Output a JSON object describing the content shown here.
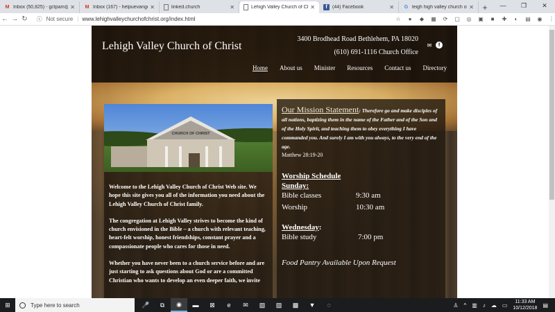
{
  "browser": {
    "tabs": [
      {
        "label": "Inbox (50,825) - gctpam@g...",
        "icon": "gmail-icon"
      },
      {
        "label": "Inbox (167) - helpuevangel...",
        "icon": "gmail-icon"
      },
      {
        "label": "linked.church",
        "icon": "document-icon"
      },
      {
        "label": "Lehigh Valley Church of Chr...",
        "icon": "document-icon",
        "active": true
      },
      {
        "label": "(44) Facebook",
        "icon": "facebook-icon"
      },
      {
        "label": "leigh high valley church of C...",
        "icon": "google-icon"
      }
    ],
    "security_label": "Not secure",
    "url": "www.lehighvalleychurchofchrist.org/index.html"
  },
  "site": {
    "title": "Lehigh Valley Church of Christ",
    "address": "3400 Brodhead Road  Bethlehem, PA 18020",
    "phone": "(610) 691-1116 Church Office",
    "nav": [
      "Home",
      "About us",
      "Minister",
      "Resources",
      "Contact us",
      "Directory"
    ],
    "photo_sign": "CHURCH OF CHRIST",
    "welcome": [
      "Welcome to the Lehigh Valley Church of Christ Web site. We hope this site gives you all of the information you need about the Lehigh Valley Church of Christ family.",
      "The congregation at Lehigh Valley strives to become the kind of church envisioned in the Bible – a church with relevant teaching, heart-felt worship, honest friendships, constant prayer and a compassionate people who cares for those in need.",
      "Whether you have never been to a church service before and are just starting to ask questions about God or are a committed Christian who wants to develop an even deeper faith, we invite"
    ],
    "mission_heading": "Our Mission Statement",
    "mission_text": ": Therefore go and make disciples of all nations, baptizing them in the name of the Father and of the Son and of the Holy Spirit, and teaching them to obey everything I have commanded you. And surely I am with you always, to the very end of the age.",
    "verse": "Matthew 28:19-20",
    "worship_heading": "Worship Schedule",
    "sunday_label": "Sunday:",
    "sunday": [
      {
        "name": "Bible classes",
        "time": "9:30 am"
      },
      {
        "name": "Worship",
        "time": "10:30 am"
      }
    ],
    "wednesday_label": "Wednesday",
    "wednesday_colon": ":",
    "wednesday": [
      {
        "name": "Bible study",
        "time": "7:00 pm"
      }
    ],
    "pantry": "Food Pantry Available Upon Request"
  },
  "taskbar": {
    "search_placeholder": "Type here to search",
    "time": "11:33 AM",
    "date": "10/12/2018"
  }
}
